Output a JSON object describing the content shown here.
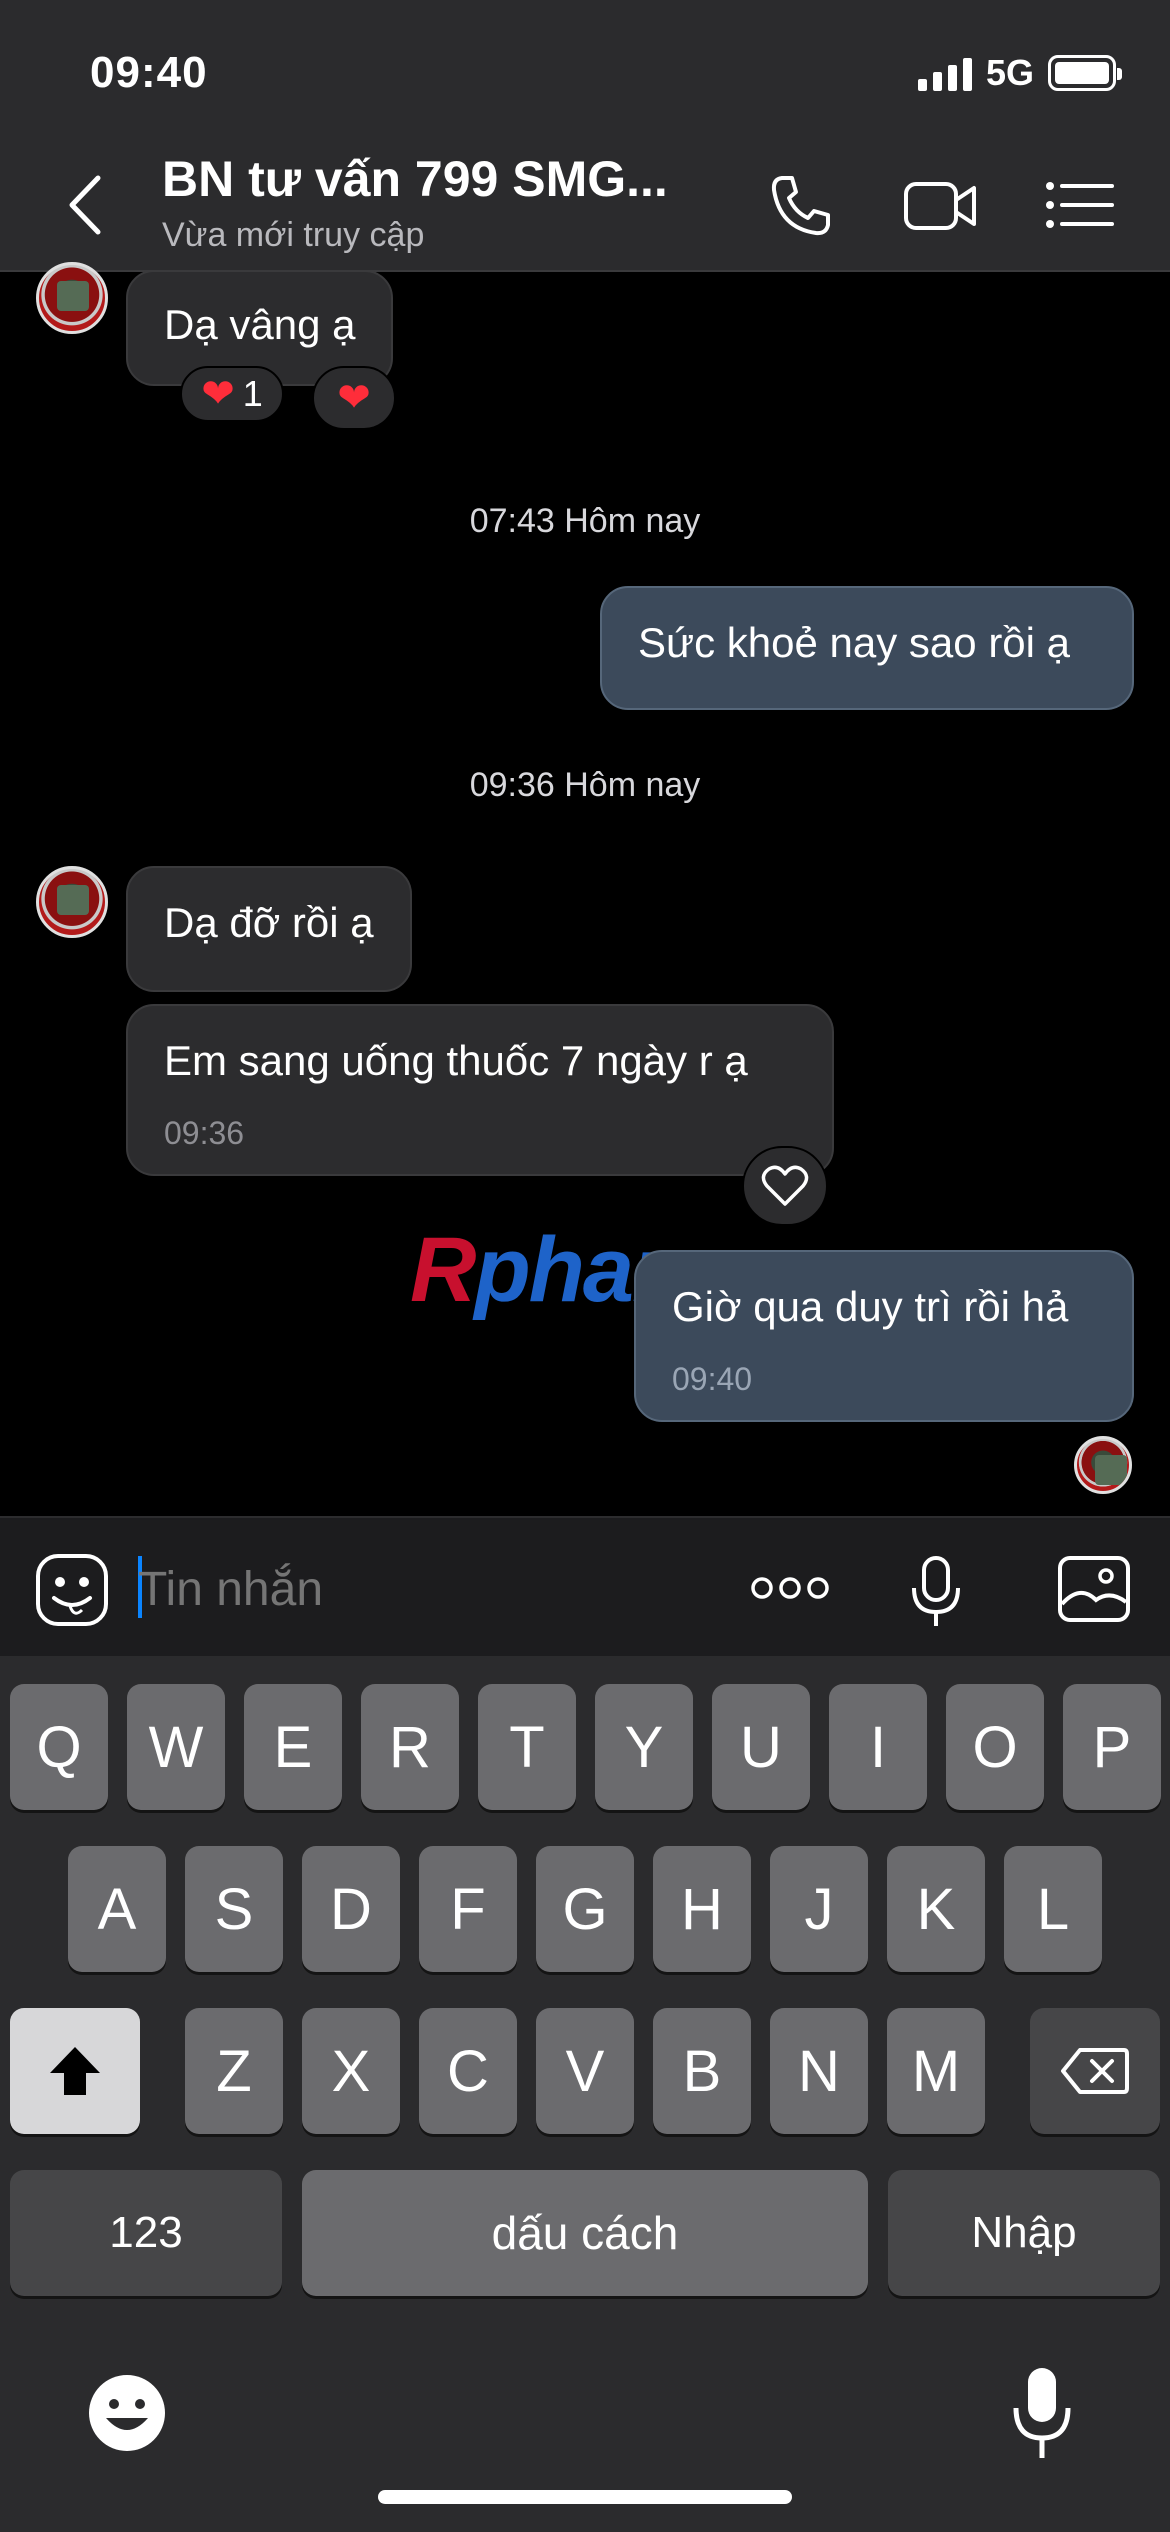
{
  "status_bar": {
    "time": "09:40",
    "network": "5G"
  },
  "header": {
    "title": "BN tư vấn 799 SMG...",
    "subtitle": "Vừa mới truy cập",
    "back_icon": "chevron-left-icon",
    "call_icon": "phone-icon",
    "video_icon": "video-camera-icon",
    "menu_icon": "list-menu-icon"
  },
  "messages": {
    "m1": {
      "text": "Dạ vâng ạ",
      "reaction_count": "1"
    },
    "sep1": "07:43 Hôm nay",
    "m2": {
      "text": "Sức khoẻ nay sao rồi ạ"
    },
    "sep2": "09:36 Hôm nay",
    "m3": {
      "text": "Dạ đỡ rồi ạ"
    },
    "m4": {
      "text": "Em sang uống thuốc 7 ngày r ạ",
      "time": "09:36"
    },
    "m5": {
      "text": "Giờ qua duy trì rồi hả",
      "time": "09:40"
    }
  },
  "watermark": {
    "part1": "R",
    "part2": "phang"
  },
  "composer": {
    "placeholder": "Tin nhắn",
    "sticker_icon": "sticker-face-icon",
    "more_icon": "more-dots-icon",
    "mic_icon": "microphone-icon",
    "image_icon": "image-icon"
  },
  "keyboard": {
    "row1": [
      "Q",
      "W",
      "E",
      "R",
      "T",
      "Y",
      "U",
      "I",
      "O",
      "P"
    ],
    "row2": [
      "A",
      "S",
      "D",
      "F",
      "G",
      "H",
      "J",
      "K",
      "L"
    ],
    "row3": [
      "Z",
      "X",
      "C",
      "V",
      "B",
      "N",
      "M"
    ],
    "numbers": "123",
    "space": "dấu cách",
    "return": "Nhập"
  },
  "colors": {
    "accent": "#0a84ff",
    "heart": "#ff2d3a",
    "outgoing_bubble": "#3c4a5b",
    "incoming_bubble": "#2c2c2e"
  }
}
